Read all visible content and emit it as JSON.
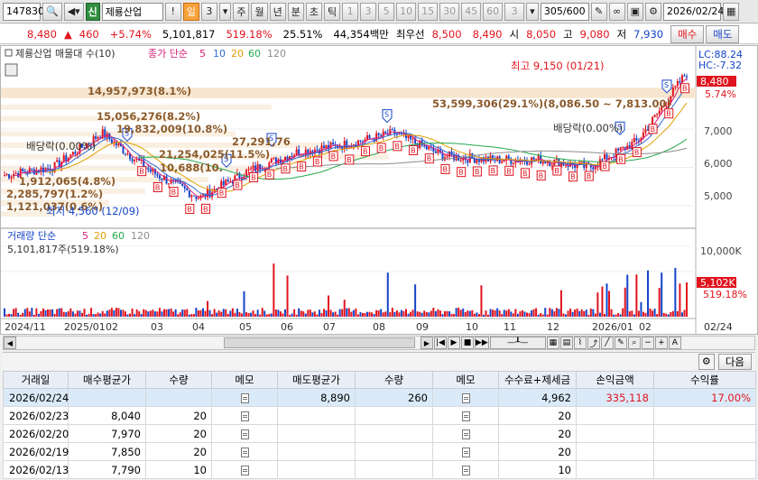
{
  "toolbar": {
    "code": "147830",
    "stock_name": "제룡산업",
    "period_buttons": [
      "일",
      "3",
      "주",
      "월",
      "년",
      "분",
      "초",
      "틱"
    ],
    "interval_buttons": [
      "1",
      "3",
      "5",
      "10",
      "15",
      "30",
      "45",
      "60",
      "3"
    ],
    "count": "305/600",
    "date": "2026/02/24",
    "exclaim": "!",
    "credit_badge": "신"
  },
  "quote": {
    "price": "8,480",
    "change_arrow": "▲",
    "change": "460",
    "change_pct": "+5.74%",
    "volume": "5,101,817",
    "volume_ratio": "519.18%",
    "turnover": "25.51%",
    "amount": "44,354백만",
    "best_ask_label": "최우선",
    "best_ask": "8,500",
    "best_bid": "8,490",
    "open_label": "시",
    "open": "8,050",
    "high_label": "고",
    "high": "9,080",
    "low_label": "저",
    "low": "7,930",
    "buy_label": "매수",
    "sell_label": "매도"
  },
  "chart": {
    "price_legend": {
      "title": "제룡산업 매물대 수(10)",
      "ma_label": "종가 단순",
      "ma_periods": [
        "5",
        "10",
        "20",
        "60",
        "120"
      ]
    },
    "volume_legend": {
      "title": "거래량 단순",
      "ma_periods": [
        "5",
        "20",
        "60",
        "120"
      ],
      "value": "5,101,817주(519.18%)"
    },
    "lc": "LC:88.24",
    "hc": "HC:-7.32",
    "current_price_tag": "8,480",
    "current_pct_tag": "5.74%",
    "current_volume_tag": "5,102K",
    "current_volume_pct_tag": "519.18%",
    "high_annotation": "최고 9,150 (01/21)",
    "low_annotation": "최저 4,560 (12/09)",
    "dividend_labels": [
      "배당락(0.00%)",
      "배당락(0.00%)"
    ],
    "volume_profile_labels": [
      "14,957,973(8.1%)",
      "15,056,276(8.2%)",
      "19,832,009(10.8%)",
      "21,254,025(11.5%)",
      "27,291,76",
      "10,688(10.",
      "1,912,065(4.8%)",
      "2,285,797(1.2%)",
      "1,121,037(0.6%)",
      "53,599,306(29.1%)(8,086.50 ~ 7,813.00)"
    ],
    "price_axis_ticks": [
      "7,000",
      "6,000",
      "5,000"
    ],
    "volume_axis_ticks": [
      "10,000K"
    ],
    "x_axis_labels": [
      "2024/11",
      "2025/01",
      "02",
      "03",
      "04",
      "05",
      "06",
      "07",
      "08",
      "09",
      "10",
      "11",
      "12",
      "2026/01",
      "02",
      "02/24"
    ],
    "colors": {
      "up": "#e0141e",
      "down": "#1544c8",
      "ma5": "#d7207a",
      "ma10": "#2f6ad0",
      "ma20": "#e0a100",
      "ma60": "#21a84b",
      "ma120": "#8c8c8c",
      "profile": "#f6e6cf"
    }
  },
  "chart_data": {
    "type": "line",
    "x": [
      "2024/11",
      "2025/01",
      "02",
      "03",
      "04",
      "05",
      "06",
      "07",
      "08",
      "09",
      "10",
      "11",
      "12",
      "2026/01",
      "02"
    ],
    "series": [
      {
        "values": [
          5800,
          6000,
          6900,
          5900,
          5200,
          5900,
          6400,
          6600,
          6900,
          6300,
          6200,
          6200,
          6000,
          6700,
          8480
        ]
      }
    ],
    "ylim": [
      4500,
      8800
    ]
  },
  "trades": {
    "headers": [
      "거래일",
      "매수평균가",
      "수량",
      "메모",
      "매도평균가",
      "수량",
      "메모",
      "수수료+제세금",
      "손익금액",
      "수익률"
    ],
    "rows": [
      {
        "date": "2026/02/24",
        "buy_avg": "",
        "buy_qty": "",
        "sell_avg": "8,890",
        "sell_qty": "260",
        "fee": "4,962",
        "pnl": "335,118",
        "ret": "17.00%"
      },
      {
        "date": "2026/02/23",
        "buy_avg": "8,040",
        "buy_qty": "20",
        "sell_avg": "",
        "sell_qty": "",
        "fee": "20",
        "pnl": "",
        "ret": ""
      },
      {
        "date": "2026/02/20",
        "buy_avg": "7,970",
        "buy_qty": "20",
        "sell_avg": "",
        "sell_qty": "",
        "fee": "20",
        "pnl": "",
        "ret": ""
      },
      {
        "date": "2026/02/19",
        "buy_avg": "7,850",
        "buy_qty": "20",
        "sell_avg": "",
        "sell_qty": "",
        "fee": "20",
        "pnl": "",
        "ret": ""
      },
      {
        "date": "2026/02/13",
        "buy_avg": "7,790",
        "buy_qty": "10",
        "sell_avg": "",
        "sell_qty": "",
        "fee": "10",
        "pnl": "",
        "ret": ""
      }
    ],
    "next_label": "다음"
  }
}
